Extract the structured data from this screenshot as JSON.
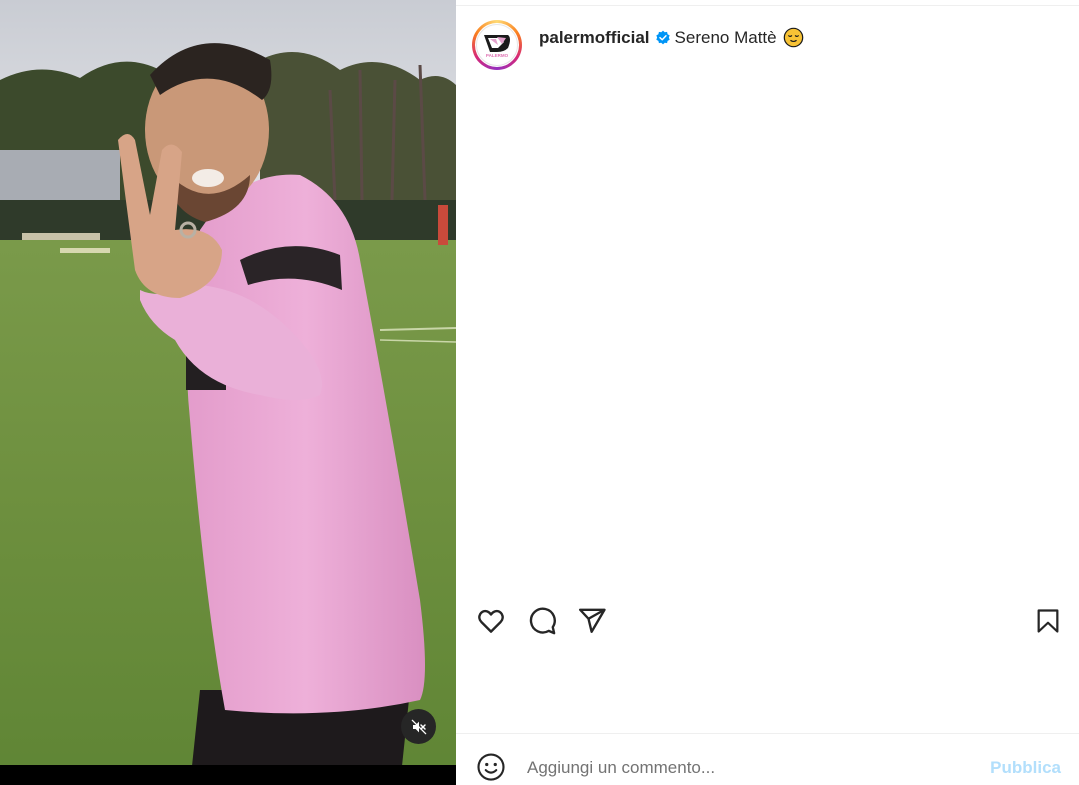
{
  "post": {
    "username": "palermofficial",
    "caption": "Sereno Mattè",
    "avatar_logo_text": "PALERMO"
  },
  "icons": {
    "verified": "verified-badge-icon",
    "caption_emoji": "relieved-face-emoji",
    "like": "heart-icon",
    "comment": "comment-icon",
    "share": "send-icon",
    "save": "bookmark-icon",
    "mute": "sound-off-icon",
    "emoji_picker": "smiley-icon"
  },
  "comment": {
    "placeholder": "Aggiungi un commento...",
    "publish_label": "Pubblica"
  },
  "colors": {
    "verified_blue": "#0095f6",
    "publish_disabled": "#b2dffc",
    "jersey_pink": "#e8a3cf"
  }
}
